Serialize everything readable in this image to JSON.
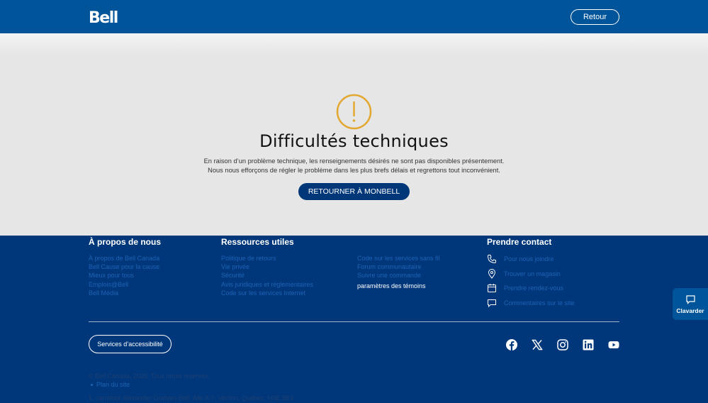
{
  "header": {
    "logo_text": "Bell",
    "back_label": "Retour"
  },
  "error": {
    "icon": "exclamation-circle-icon",
    "icon_color": "#e2a832",
    "title": "Difficultés techniques",
    "line1": "En raison d’un problème technique, les renseignements désirés ne sont pas disponibles présentement.",
    "line2": "Nous nous efforçons de régler le problème dans les plus brefs délais et regrettons tout inconvénient.",
    "button_label": "RETOURNER À MONBELL"
  },
  "footer": {
    "about": {
      "heading": "À propos de nous",
      "links": [
        "À propos de Bell Canada",
        "Bell Cause pour la cause",
        "Mieux pour tous",
        "Emplois@Bell",
        "Bell Média"
      ]
    },
    "resources": {
      "heading": "Ressources utiles",
      "links_col1": [
        "Politique de retours",
        "Vie privée",
        "Sécurité",
        "Avis juridiques et réglementaires",
        "Code sur les services Internet"
      ],
      "links_col2": [
        "Code sur les services sans fil",
        "Forum communautaire",
        "Suivre une commande",
        "paramètres des témoins"
      ]
    },
    "contact": {
      "heading": "Prendre contact",
      "items": [
        {
          "icon": "phone-icon",
          "label": "Pour nous joindre"
        },
        {
          "icon": "location-pin-icon",
          "label": "Trouver un magasin"
        },
        {
          "icon": "calendar-icon",
          "label": "Prendre rendez-vous"
        },
        {
          "icon": "speech-bubble-icon",
          "label": "Commentaires sur le site"
        }
      ]
    },
    "accessibility_label": "Services d’accessibilité",
    "social": [
      "facebook-icon",
      "x-icon",
      "instagram-icon",
      "linkedin-icon",
      "youtube-icon"
    ],
    "copyright": "© Bell Canada, 2026. Tous droits réservés.",
    "sitemap": "Plan du site",
    "address": "1, carrefour Alexander-Graham-Bell, Aile A-7, Verdun, Québec, H3E 3B3"
  },
  "chat": {
    "label": "Clavarder",
    "icon": "chat-icon"
  },
  "colors": {
    "header_blue": "#00549a",
    "footer_navy": "#00377a",
    "button_navy": "#003778",
    "link_blue": "#1d62b5",
    "warning_orange": "#e2a832"
  }
}
